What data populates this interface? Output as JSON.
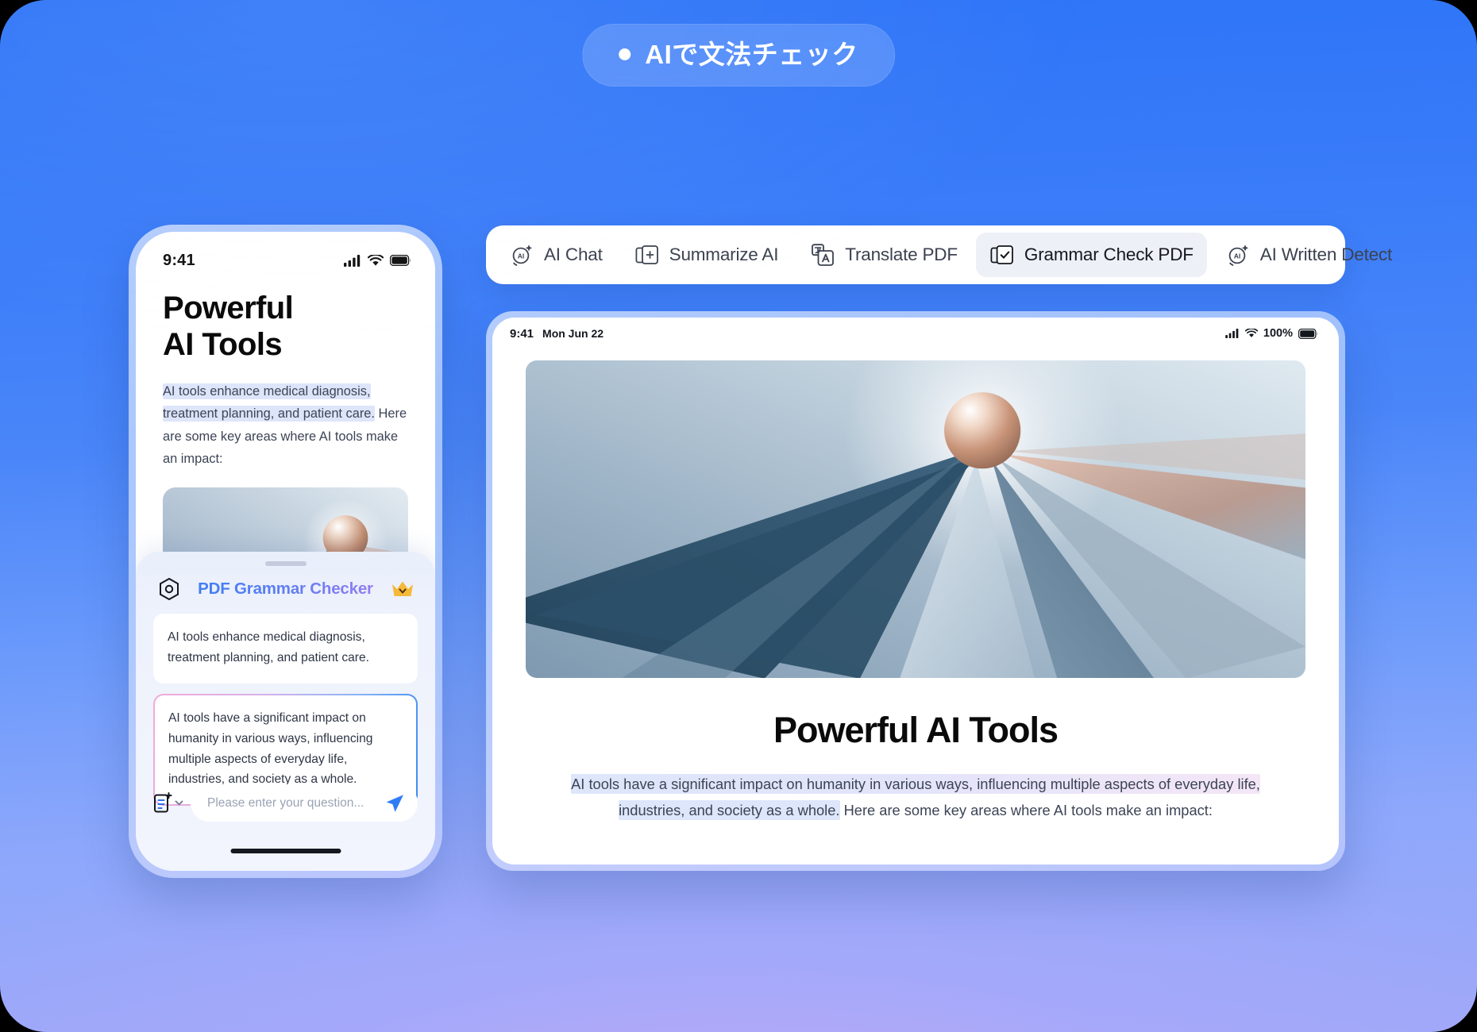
{
  "badge": {
    "text": "AIで文法チェック",
    "dot_icon": "bullet-dot-icon"
  },
  "colors": {
    "background_top": "#2d74f8",
    "background_bottom": "#a3a9f8",
    "accent_blue": "#3b8bf6",
    "accent_purple": "#9f7df0",
    "highlight_blue": "#dde5fb",
    "highlight_pink": "#f4e6f6",
    "crown_gold": "#f5b938",
    "tab_active_bg": "#eef0f7"
  },
  "tabbar": {
    "tabs": [
      {
        "label": "AI Chat",
        "icon": "ai-sparkle-circle-icon",
        "active": false
      },
      {
        "label": "Summarize AI",
        "icon": "summarize-doc-icon",
        "active": false
      },
      {
        "label": "Translate PDF",
        "icon": "translate-letter-icon",
        "active": false
      },
      {
        "label": "Grammar Check PDF",
        "icon": "grammar-check-doc-icon",
        "active": true
      },
      {
        "label": "AI Written Detect",
        "icon": "ai-sparkle-circle-icon",
        "active": false
      }
    ]
  },
  "phone": {
    "status": {
      "time": "9:41",
      "cellular_icon": "cellular-bars-icon",
      "wifi_icon": "wifi-icon",
      "battery_icon": "battery-full-icon"
    },
    "title_line1": "Powerful",
    "title_line2": "AI Tools",
    "paragraph": {
      "highlighted": "AI tools enhance medical diagnosis, treatment planning, and patient care.",
      "rest": "Here are some key areas where AI tools make an impact:"
    },
    "hero_image_alt": "abstract-sphere-prism-art",
    "sheet": {
      "grabber": "drag-handle",
      "left_icon": "hexagon-target-icon",
      "title": "PDF Grammar Checker",
      "right_icon": "crown-premium-icon",
      "original_text": "AI tools enhance medical diagnosis, treatment planning, and patient care.",
      "corrected_text": "AI tools have a significant impact on humanity in various ways, influencing multiple aspects of everyday life, industries, and society as a whole.",
      "input": {
        "doc_icon": "document-add-icon",
        "chevron_icon": "chevron-down-icon",
        "placeholder": "Please enter your question...",
        "value": "",
        "send_icon": "send-paper-plane-icon"
      }
    }
  },
  "tablet": {
    "status": {
      "time": "9:41",
      "date": "Mon Jun 22",
      "cellular_icon": "cellular-bars-icon",
      "wifi_icon": "wifi-icon",
      "battery_percent": "100%",
      "battery_icon": "battery-full-icon"
    },
    "hero_image_alt": "abstract-sphere-prism-art",
    "title": "Powerful AI Tools",
    "paragraph": {
      "highlighted_part1": "AI tools have a significant impact on humanity in various ways, influencing multiple aspects of everyday life,",
      "highlighted_part2": "industries, and society as a whole.",
      "rest": " Here are some key areas where AI tools make an impact:"
    }
  }
}
